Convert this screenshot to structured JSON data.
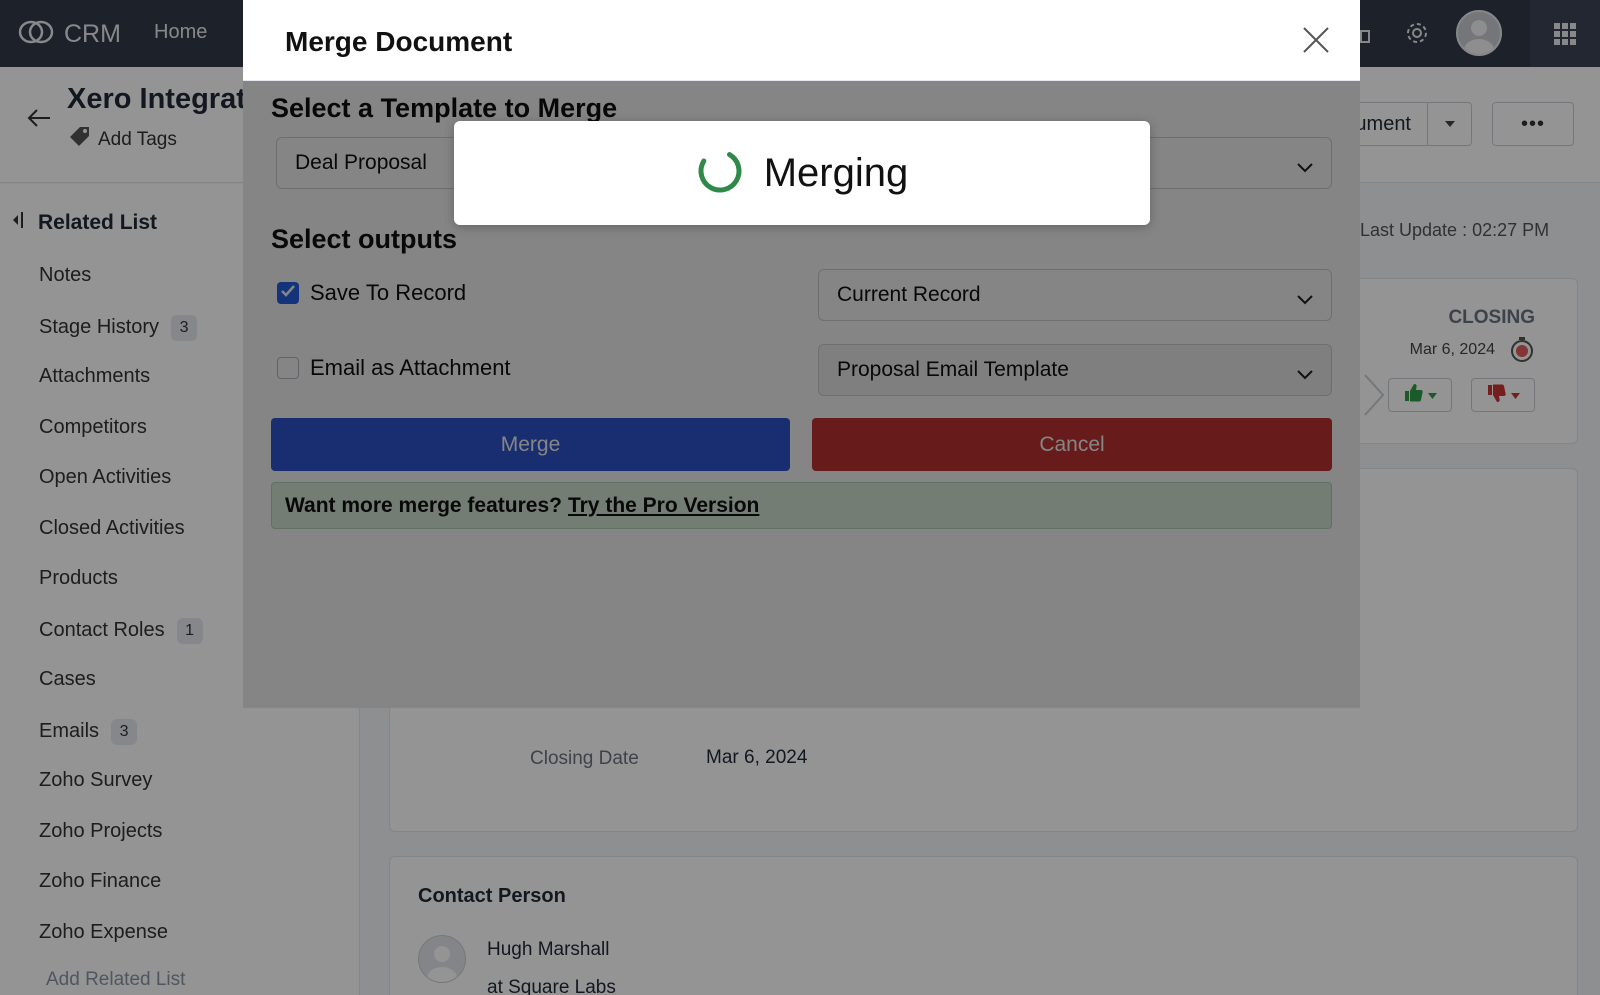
{
  "topbar": {
    "brand": "CRM",
    "nav_home": "Home"
  },
  "record": {
    "title": "Xero Integrat",
    "add_tags": "Add Tags",
    "doc_button_label": "ument",
    "more_label": "•••",
    "last_update": "Last Update : 02:27 PM"
  },
  "sidebar": {
    "header": "Related List",
    "items": [
      {
        "label": "Notes",
        "count": ""
      },
      {
        "label": "Stage History",
        "count": "3"
      },
      {
        "label": "Attachments",
        "count": ""
      },
      {
        "label": "Competitors",
        "count": ""
      },
      {
        "label": "Open Activities",
        "count": ""
      },
      {
        "label": "Closed Activities",
        "count": ""
      },
      {
        "label": "Products",
        "count": ""
      },
      {
        "label": "Contact Roles",
        "count": "1"
      },
      {
        "label": "Cases",
        "count": ""
      },
      {
        "label": "Emails",
        "count": "3"
      },
      {
        "label": "Zoho Survey",
        "count": ""
      },
      {
        "label": "Zoho Projects",
        "count": ""
      },
      {
        "label": "Zoho Finance",
        "count": ""
      },
      {
        "label": "Zoho Expense",
        "count": ""
      }
    ],
    "add_related": "Add Related List"
  },
  "stage": {
    "closing": "CLOSING",
    "date": "Mar 6, 2024"
  },
  "details": {
    "closing_date_label": "Closing Date",
    "closing_date_value": "Mar 6, 2024"
  },
  "contact": {
    "title": "Contact Person",
    "name": "Hugh Marshall",
    "company": "at Square Labs"
  },
  "dialog": {
    "title": "Merge Document",
    "template_section": "Select a Template to Merge",
    "template_value": "Deal Proposal",
    "outputs_section": "Select outputs",
    "save_to_record": "Save To Record",
    "save_to_record_checked": true,
    "save_target": "Current Record",
    "email_attachment": "Email as Attachment",
    "email_attachment_checked": false,
    "email_template": "Proposal Email Template",
    "merge_button": "Merge",
    "cancel_button": "Cancel",
    "promo_text": "Want more merge features?",
    "promo_link": "Try the Pro Version"
  },
  "loading": {
    "text": "Merging"
  },
  "colors": {
    "topbar": "#313949",
    "merge_button": "#2f58d8",
    "cancel_button": "#c83434",
    "promo_bg": "#dcefdf",
    "spinner": "#2f8a4a",
    "thumb_up": "#2e9e48",
    "thumb_down": "#c83434"
  },
  "icons": [
    "crm-logo-icon",
    "settings-icon",
    "gift-icon",
    "apps-grid-icon",
    "back-arrow-icon",
    "tag-icon",
    "chevron-down-icon",
    "close-icon",
    "check-icon",
    "spinner-icon",
    "timer-icon",
    "thumbs-up-icon",
    "thumbs-down-icon",
    "collapse-icon"
  ]
}
